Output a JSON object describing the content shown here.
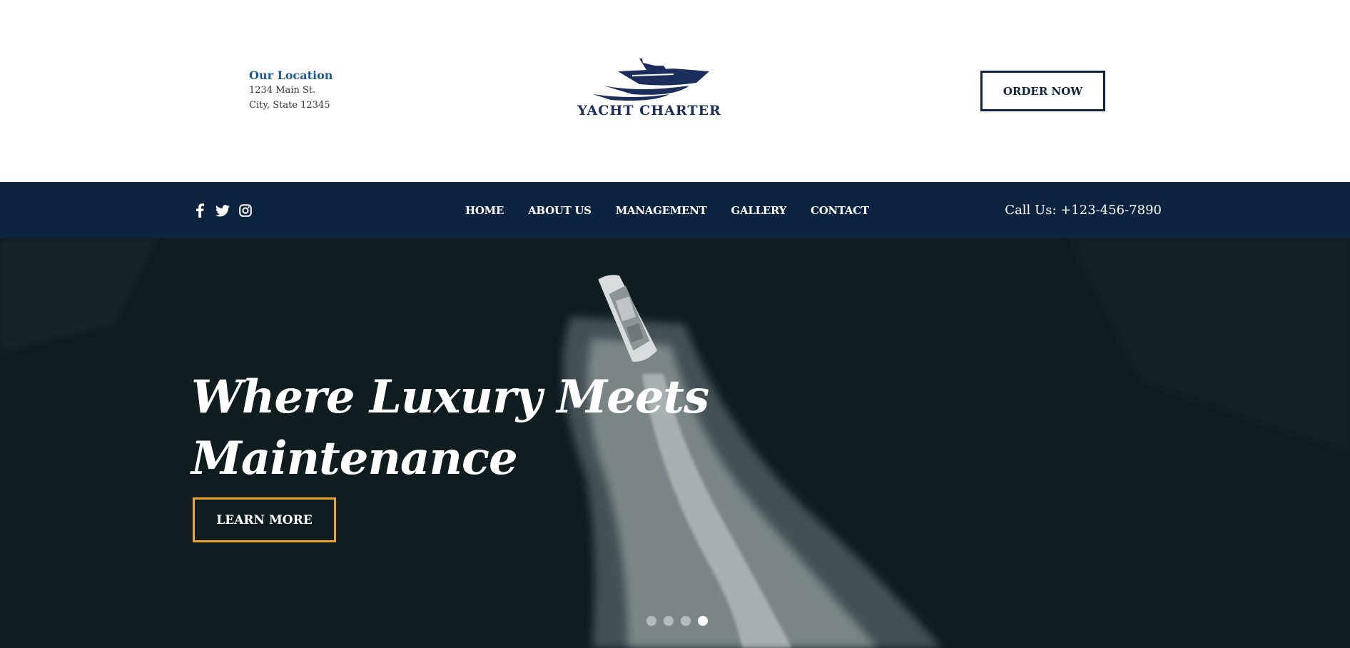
{
  "header": {
    "location": {
      "title": "Our Location",
      "line1": "1234 Main St.",
      "line2": "City, State 12345"
    },
    "logo_text": "YACHT CHARTER",
    "order_button": "ORDER NOW"
  },
  "navbar": {
    "social": [
      "facebook-icon",
      "twitter-icon",
      "instagram-icon"
    ],
    "links": [
      "HOME",
      "ABOUT US",
      "MANAGEMENT",
      "GALLERY",
      "CONTACT"
    ],
    "call": "Call Us: +123-456-7890"
  },
  "hero": {
    "headline_line1": "Where Luxury Meets",
    "headline_line2": "Maintenance",
    "button": "LEARN MORE",
    "slides": 4,
    "active_slide": 4
  },
  "colors": {
    "nav_bg": "#0c2440",
    "location_title": "#1f5a8f",
    "logo": "#1c2f5c",
    "accent_border": "#f0a526"
  }
}
